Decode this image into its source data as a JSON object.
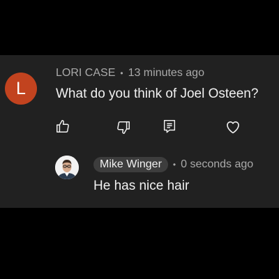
{
  "comment": {
    "avatar_letter": "L",
    "avatar_color": "#c2431f",
    "author": "LORI CASE",
    "separator": "•",
    "time": "13 minutes ago",
    "text": "What do you think of Joel Osteen?",
    "actions": [
      "like-icon",
      "dislike-icon",
      "reply-icon",
      "heart-icon"
    ]
  },
  "reply": {
    "author": "Mike Winger",
    "separator": "•",
    "time": "0 seconds ago",
    "text": "He has nice hair"
  },
  "colors": {
    "background": "#000000",
    "panel": "#212121",
    "text": "#f1f1f1",
    "secondary_text": "#aaaaaa",
    "author_chip": "#3d3d3d"
  }
}
